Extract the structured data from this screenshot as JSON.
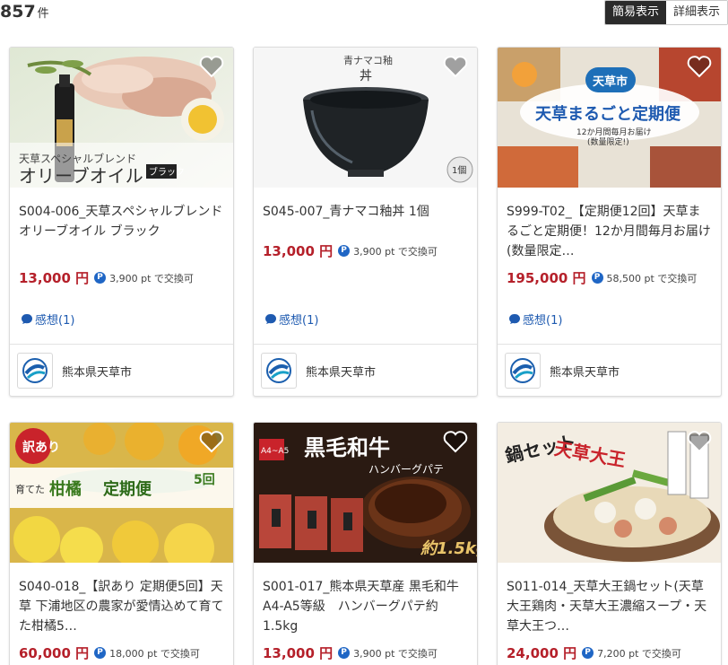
{
  "header": {
    "count": "857",
    "count_unit": "件",
    "views": [
      {
        "label": "簡易表示",
        "active": true
      },
      {
        "label": "詳細表示",
        "active": false
      }
    ]
  },
  "products": [
    {
      "title": "S004-006_天草スペシャルブレンドオリーブオイル ブラック",
      "price": "13,000 円",
      "points": "3,900 pt で交換可",
      "review": "感想(1)",
      "municipality": "熊本県天草市",
      "image_text": {
        "small": "天草スペシャルブレンド",
        "large": "オリーブオイル",
        "badge": "ブラック"
      }
    },
    {
      "title": "S045-007_青ナマコ釉丼 1個",
      "price": "13,000 円",
      "points": "3,900 pt で交換可",
      "review": "感想(1)",
      "municipality": "熊本県天草市",
      "image_text": {
        "small": "青ナマコ釉",
        "large": "丼",
        "badge": "1個"
      }
    },
    {
      "title": "S999-T02_【定期便12回】天草まるごと定期便！12か月間毎月お届け(数量限定…",
      "price": "195,000 円",
      "points": "58,500 pt で交換可",
      "review": "感想(1)",
      "municipality": "熊本県天草市",
      "image_text": {
        "logo": "天草市",
        "large": "天草まるごと定期便",
        "sub1": "12か月間毎月お届け",
        "sub2": "(数量限定!)"
      }
    },
    {
      "title": "S040-018_【訳あり 定期便5回】天草 下浦地区の農家が愛情込めて育てた柑橘5…",
      "price": "60,000 円",
      "points": "18,000 pt で交換可",
      "image_text": {
        "badge": "訳あり",
        "small": "育てた",
        "large": "柑橘",
        "sub": "定期便",
        "count": "5回"
      }
    },
    {
      "title": "S001-017_熊本県天草産 黒毛和牛A4-A5等級　ハンバーグパテ約1.5kg",
      "price": "13,000 円",
      "points": "3,900 pt で交換可",
      "image_text": {
        "large": "黒毛和牛",
        "sub": "ハンバーグパテ",
        "grade": "A4~A5",
        "weight": "約1.5kg"
      }
    },
    {
      "title": "S011-014_天草大王鍋セット(天草大王鶏肉・天草大王濃縮スープ・天草大王つ…",
      "price": "24,000 円",
      "points": "7,200 pt で交換可",
      "image_text": {
        "left": "鍋セット",
        "right": "天草大王"
      }
    }
  ],
  "colors": {
    "price": "#b5202a",
    "point_badge": "#1f66c5",
    "review_link": "#1e5ab0",
    "active_toggle": "#2b2b2b"
  },
  "icons": {
    "favorite": "heart-icon",
    "review": "speech-bubble-icon",
    "point": "p-badge-icon",
    "municipality": "amakusa-city-logo"
  }
}
